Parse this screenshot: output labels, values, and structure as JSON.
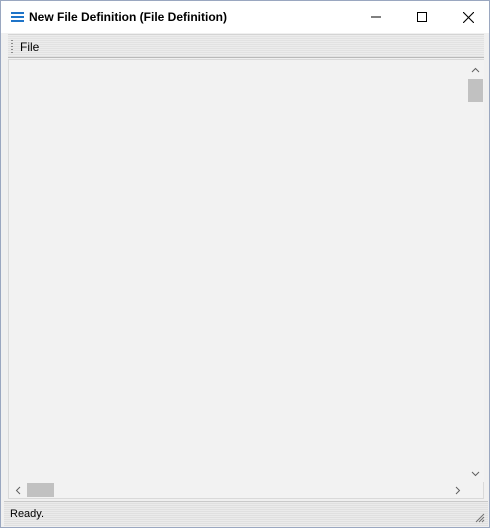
{
  "window": {
    "title": "New File Definition (File Definition)",
    "controls": {
      "minimize_icon": "minimize-icon",
      "maximize_icon": "maximize-icon",
      "close_icon": "close-icon"
    },
    "app_icon": "list-icon",
    "accent": "#1f74c8"
  },
  "menubar": {
    "items": [
      {
        "label": "File"
      }
    ]
  },
  "status": {
    "text": "Ready."
  }
}
